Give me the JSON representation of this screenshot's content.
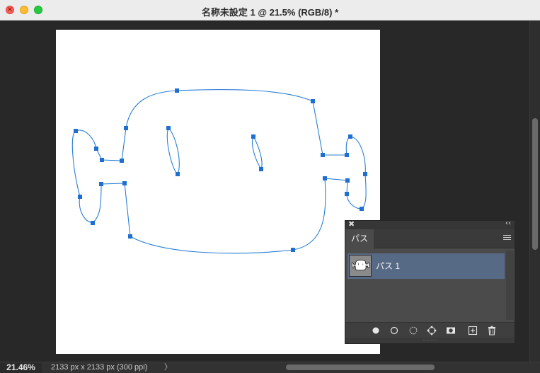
{
  "window": {
    "title": "名称未設定 1 @ 21.5% (RGB/8) *",
    "close_glyph": "×"
  },
  "status": {
    "zoom": "21.46%",
    "doc_info": "2133 px x 2133 px (300 ppi)",
    "arrow": "〉"
  },
  "paths_panel": {
    "close_glyph": "✖",
    "collapse_glyph": "‹‹",
    "tab_label": "パス",
    "items": [
      {
        "label": "パス 1",
        "selected": true
      }
    ],
    "footer_icons": [
      "fill-path-icon",
      "stroke-path-icon",
      "load-selection-icon",
      "make-work-path-icon",
      "add-mask-icon",
      "new-path-icon",
      "delete-path-icon"
    ]
  },
  "colors": {
    "path_stroke": "#2b7fd6",
    "anchor_fill": "#1f6fd1",
    "selected_row": "#566a86"
  }
}
